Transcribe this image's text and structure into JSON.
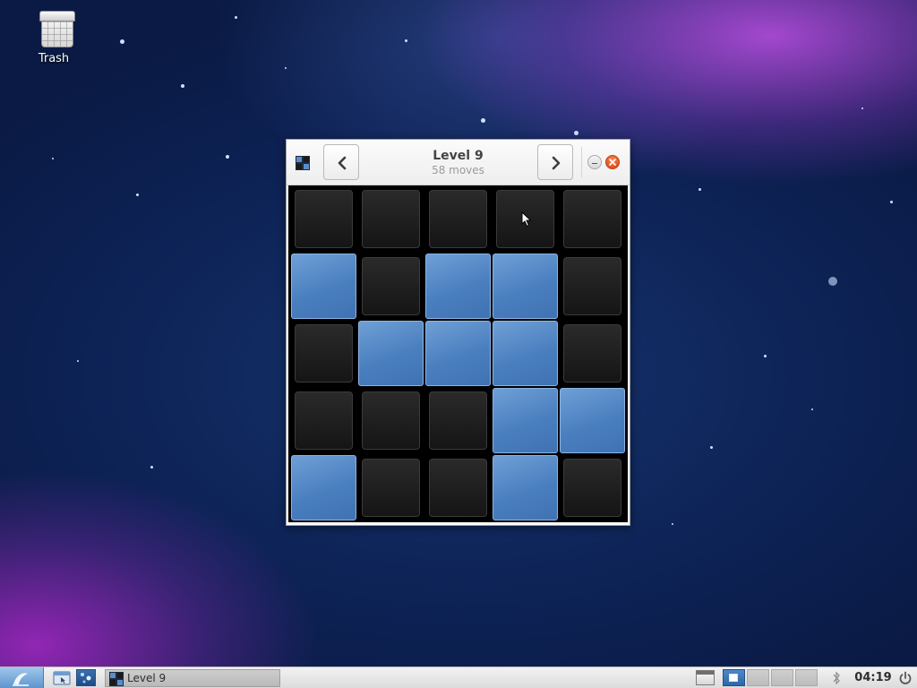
{
  "desktop": {
    "icons": [
      {
        "name": "trash-icon",
        "label": "Trash"
      }
    ]
  },
  "window": {
    "title": "Level 9",
    "subtitle": "58 moves",
    "app_icon": "lights-off-icon",
    "prev_icon": "chevron-left-icon",
    "next_icon": "chevron-right-icon",
    "minimize_icon": "minimize-icon",
    "close_icon": "close-icon"
  },
  "board": {
    "rows": 5,
    "cols": 5,
    "lit_color": "#5b8ccb",
    "dark_color": "#1e1e1e",
    "grid": [
      [
        0,
        0,
        0,
        0,
        0
      ],
      [
        1,
        0,
        1,
        1,
        0
      ],
      [
        0,
        1,
        1,
        1,
        0
      ],
      [
        0,
        0,
        0,
        1,
        1
      ],
      [
        1,
        0,
        0,
        1,
        0
      ]
    ]
  },
  "taskbar": {
    "start_icon": "lxde-menu-icon",
    "launchers": [
      "file-manager-icon",
      "lights-off-icon"
    ],
    "tasks": [
      {
        "label": "Level 9",
        "icon": "lights-off-icon",
        "active": true
      }
    ],
    "workspaces": [
      {
        "active": true
      },
      {
        "active": false
      },
      {
        "active": false
      },
      {
        "active": false
      }
    ],
    "tray_icons": [
      "window-list-icon",
      "bluetooth-icon"
    ],
    "clock": "04:19",
    "power_icon": "power-icon"
  }
}
